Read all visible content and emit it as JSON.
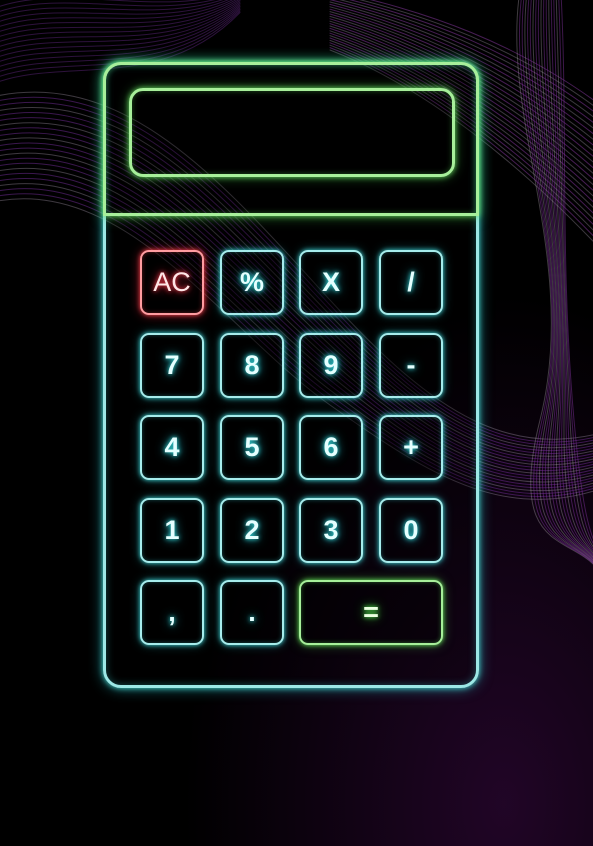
{
  "display": {
    "value": ""
  },
  "keys": {
    "clear": "AC",
    "percent": "%",
    "multiply": "X",
    "divide": "/",
    "seven": "7",
    "eight": "8",
    "nine": "9",
    "minus": "-",
    "four": "4",
    "five": "5",
    "six": "6",
    "plus": "+",
    "one": "1",
    "two": "2",
    "three": "3",
    "zero": "0",
    "comma": ",",
    "dot": ".",
    "equals": "="
  },
  "colors": {
    "background": "#000000",
    "body_glow": "#9ce8e6",
    "display_glow": "#a7ef9a",
    "clear_glow": "#ff9ca0",
    "equals_glow": "#a7ef9a",
    "background_streaks": "#6a2a8c"
  }
}
